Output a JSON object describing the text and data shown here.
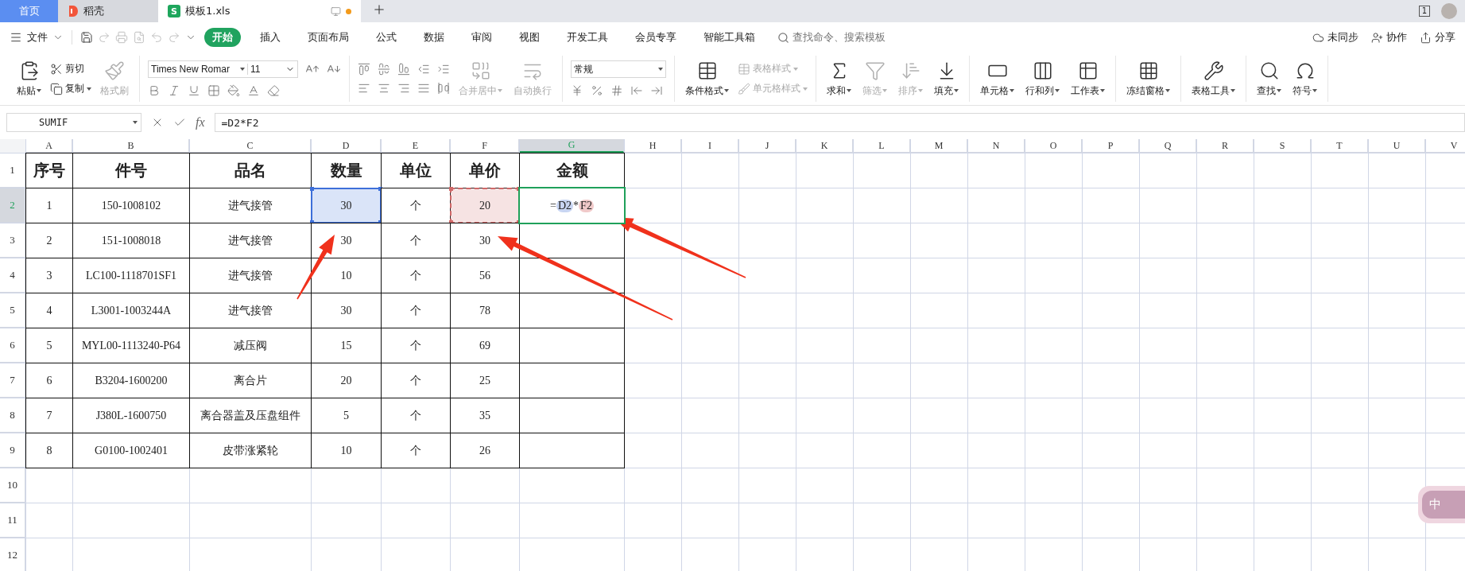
{
  "title_bar": {
    "tabs": [
      {
        "label": "首页",
        "kind": "home",
        "selected": false
      },
      {
        "label": "稻壳",
        "kind": "docer",
        "selected": false
      },
      {
        "label": "模板1.xls",
        "kind": "sheet",
        "selected": true,
        "badge": "S",
        "unsaved": true
      }
    ],
    "window_count": "1"
  },
  "menu_bar": {
    "file": "文件",
    "tabs": [
      {
        "label": "开始",
        "selected": true
      },
      {
        "label": "插入",
        "selected": false
      },
      {
        "label": "页面布局",
        "selected": false
      },
      {
        "label": "公式",
        "selected": false
      },
      {
        "label": "数据",
        "selected": false
      },
      {
        "label": "审阅",
        "selected": false
      },
      {
        "label": "视图",
        "selected": false
      },
      {
        "label": "开发工具",
        "selected": false
      },
      {
        "label": "会员专享",
        "selected": false
      },
      {
        "label": "智能工具箱",
        "selected": false
      }
    ],
    "search": {
      "placeholder": "查找命令、搜索模板"
    },
    "actions": [
      "未同步",
      "协作",
      "分享"
    ]
  },
  "ribbon": {
    "groups": [
      {
        "columns": [
          {
            "kind": "large",
            "label": "粘贴",
            "caret": true,
            "disabled": false
          },
          {
            "kind": "stack",
            "items": [
              {
                "label": "剪切",
                "caret": false,
                "disabled": false
              },
              {
                "label": "复制",
                "caret": true,
                "disabled": false
              }
            ]
          },
          {
            "kind": "large",
            "label": "格式刷",
            "caret": false,
            "disabled": true
          }
        ]
      },
      {
        "columns": [
          {
            "kind": "font",
            "font_name": "Times New Romar",
            "font_size": "11"
          }
        ]
      },
      {
        "columns": [
          {
            "kind": "align"
          },
          {
            "kind": "large",
            "label": "合并居中",
            "caret": true,
            "disabled": true
          },
          {
            "kind": "large",
            "label": "自动换行",
            "caret": false,
            "disabled": true
          }
        ]
      },
      {
        "columns": [
          {
            "kind": "number",
            "format": "常规"
          }
        ]
      },
      {
        "columns": [
          {
            "kind": "large",
            "label": "条件格式",
            "caret": true,
            "disabled": false
          },
          {
            "kind": "stack",
            "items": [
              {
                "label": "表格样式",
                "caret": true,
                "disabled": true
              },
              {
                "label": "单元格样式",
                "caret": true,
                "disabled": true
              }
            ]
          }
        ]
      },
      {
        "columns": [
          {
            "kind": "large",
            "label": "求和",
            "caret": true,
            "disabled": false
          },
          {
            "kind": "large",
            "label": "筛选",
            "caret": true,
            "disabled": true
          },
          {
            "kind": "large",
            "label": "排序",
            "caret": true,
            "disabled": true
          },
          {
            "kind": "large",
            "label": "填充",
            "caret": true,
            "disabled": false
          }
        ]
      },
      {
        "columns": [
          {
            "kind": "large",
            "label": "单元格",
            "caret": true,
            "disabled": false
          },
          {
            "kind": "large",
            "label": "行和列",
            "caret": true,
            "disabled": false
          },
          {
            "kind": "large",
            "label": "工作表",
            "caret": true,
            "disabled": false
          }
        ]
      },
      {
        "columns": [
          {
            "kind": "large",
            "label": "冻结窗格",
            "caret": true,
            "disabled": false
          }
        ]
      },
      {
        "columns": [
          {
            "kind": "large",
            "label": "表格工具",
            "caret": true,
            "disabled": false
          }
        ]
      },
      {
        "columns": [
          {
            "kind": "large",
            "label": "查找",
            "caret": true,
            "disabled": false
          },
          {
            "kind": "large",
            "label": "符号",
            "caret": true,
            "disabled": false
          }
        ]
      }
    ]
  },
  "formula_bar": {
    "name_box": "SUMIF",
    "function_label": "fx",
    "formula": "=D2*F2"
  },
  "sheet": {
    "columns": [
      {
        "label": "A",
        "selected": false
      },
      {
        "label": "B",
        "selected": false
      },
      {
        "label": "C",
        "selected": false
      },
      {
        "label": "D",
        "selected": false
      },
      {
        "label": "E",
        "selected": false
      },
      {
        "label": "F",
        "selected": false
      },
      {
        "label": "G",
        "selected": true
      },
      {
        "label": "H",
        "selected": false
      },
      {
        "label": "I",
        "selected": false
      },
      {
        "label": "J",
        "selected": false
      },
      {
        "label": "K",
        "selected": false
      },
      {
        "label": "L",
        "selected": false
      },
      {
        "label": "M",
        "selected": false
      },
      {
        "label": "N",
        "selected": false
      },
      {
        "label": "O",
        "selected": false
      },
      {
        "label": "P",
        "selected": false
      },
      {
        "label": "Q",
        "selected": false
      },
      {
        "label": "R",
        "selected": false
      },
      {
        "label": "S",
        "selected": false
      },
      {
        "label": "T",
        "selected": false
      },
      {
        "label": "U",
        "selected": false
      },
      {
        "label": "V",
        "selected": false
      }
    ],
    "rows": [
      {
        "number": "1",
        "kind": "header",
        "selected": false,
        "cells": [
          "序号",
          "件号",
          "品名",
          "数量",
          "单位",
          "单价",
          "金额"
        ]
      },
      {
        "number": "2",
        "kind": "data",
        "selected": true,
        "cells": [
          "1",
          "150-1008102",
          "进气接管",
          {
            "text": "30",
            "kind": "ref",
            "color": "#3d6fd9"
          },
          "个",
          {
            "text": "20",
            "kind": "ref",
            "color": "#d06868"
          },
          {
            "kind": "editing",
            "parts": [
              {
                "text": "=",
                "kind": "op"
              },
              {
                "text": "D2",
                "kind": "ref",
                "color": "#c8d5f2"
              },
              {
                "text": "*",
                "kind": "op"
              },
              {
                "text": "F2",
                "kind": "ref",
                "color": "#f0c9c9"
              }
            ]
          }
        ]
      },
      {
        "number": "3",
        "kind": "data",
        "selected": false,
        "cells": [
          "2",
          "151-1008018",
          "进气接管",
          "30",
          "个",
          "30",
          ""
        ]
      },
      {
        "number": "4",
        "kind": "data",
        "selected": false,
        "cells": [
          "3",
          "LC100-1118701SF1",
          "进气接管",
          "10",
          "个",
          "56",
          ""
        ]
      },
      {
        "number": "5",
        "kind": "data",
        "selected": false,
        "cells": [
          "4",
          "L3001-1003244A",
          "进气接管",
          "30",
          "个",
          "78",
          ""
        ]
      },
      {
        "number": "6",
        "kind": "data",
        "selected": false,
        "cells": [
          "5",
          "MYL00-1113240-P64",
          "减压阀",
          "15",
          "个",
          "69",
          ""
        ]
      },
      {
        "number": "7",
        "kind": "data",
        "selected": false,
        "cells": [
          "6",
          "B3204-1600200",
          "离合片",
          "20",
          "个",
          "25",
          ""
        ]
      },
      {
        "number": "8",
        "kind": "data",
        "selected": false,
        "cells": [
          "7",
          "J380L-1600750",
          "离合器盖及压盘组件",
          "5",
          "个",
          "35",
          ""
        ]
      },
      {
        "number": "9",
        "kind": "data",
        "selected": false,
        "cells": [
          "8",
          "G0100-1002401",
          "皮带涨紧轮",
          "10",
          "个",
          "26",
          ""
        ]
      },
      {
        "number": "10",
        "kind": "empty",
        "selected": false
      },
      {
        "number": "11",
        "kind": "empty",
        "selected": false
      },
      {
        "number": "12",
        "kind": "empty",
        "selected": false
      }
    ]
  },
  "ime_badge": {
    "label": "中"
  }
}
